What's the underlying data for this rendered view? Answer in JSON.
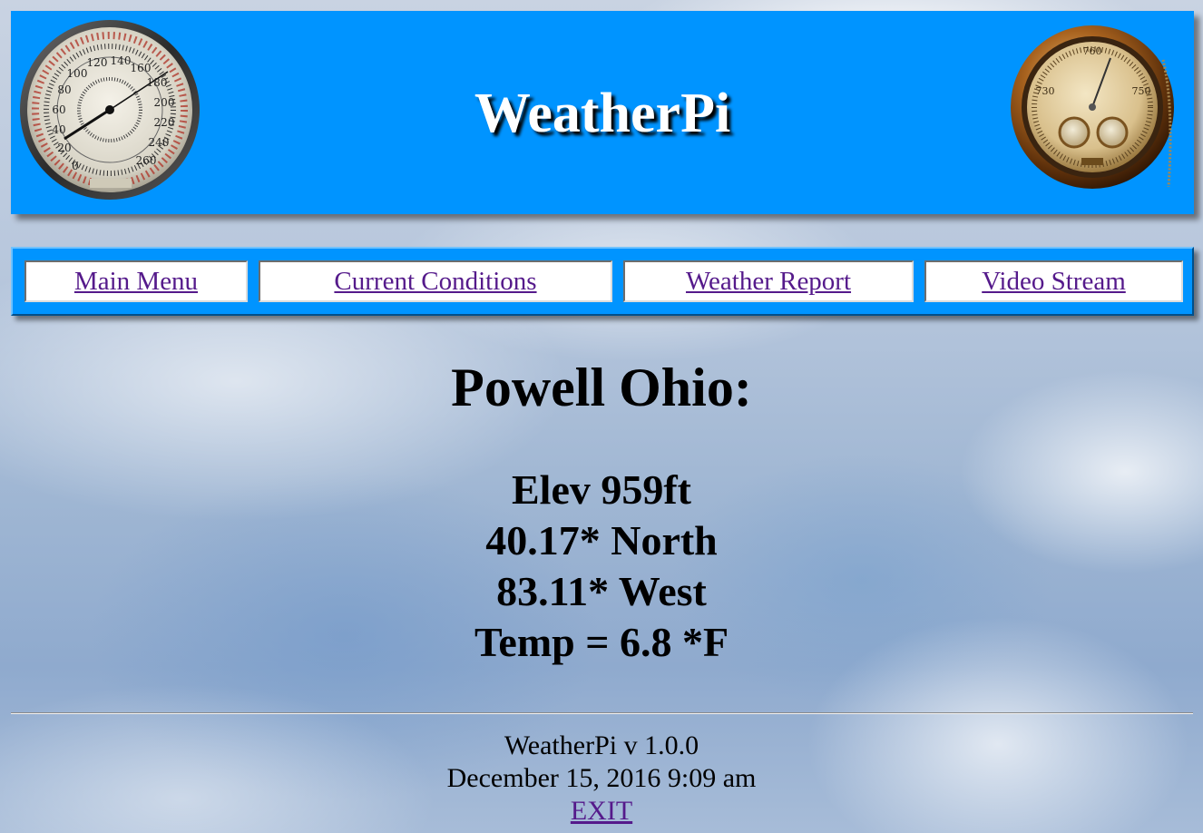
{
  "header": {
    "title": "WeatherPi",
    "left_gauge_icon": "pressure-gauge-icon",
    "right_gauge_icon": "barometer-icon"
  },
  "nav": {
    "items": [
      {
        "label": "Main Menu"
      },
      {
        "label": "Current Conditions"
      },
      {
        "label": "Weather Report"
      },
      {
        "label": "Video Stream"
      }
    ]
  },
  "main": {
    "location": "Powell Ohio:",
    "elevation": "Elev 959ft",
    "latitude": "40.17* North",
    "longitude": "83.11* West",
    "temperature": "Temp = 6.8 *F"
  },
  "footer": {
    "version": "WeatherPi v 1.0.0",
    "datetime": "December 15, 2016 9:09 am",
    "exit_label": "EXIT"
  },
  "colors": {
    "banner": "#0094ff",
    "link": "#551a8b",
    "title_text": "#ffffff"
  }
}
